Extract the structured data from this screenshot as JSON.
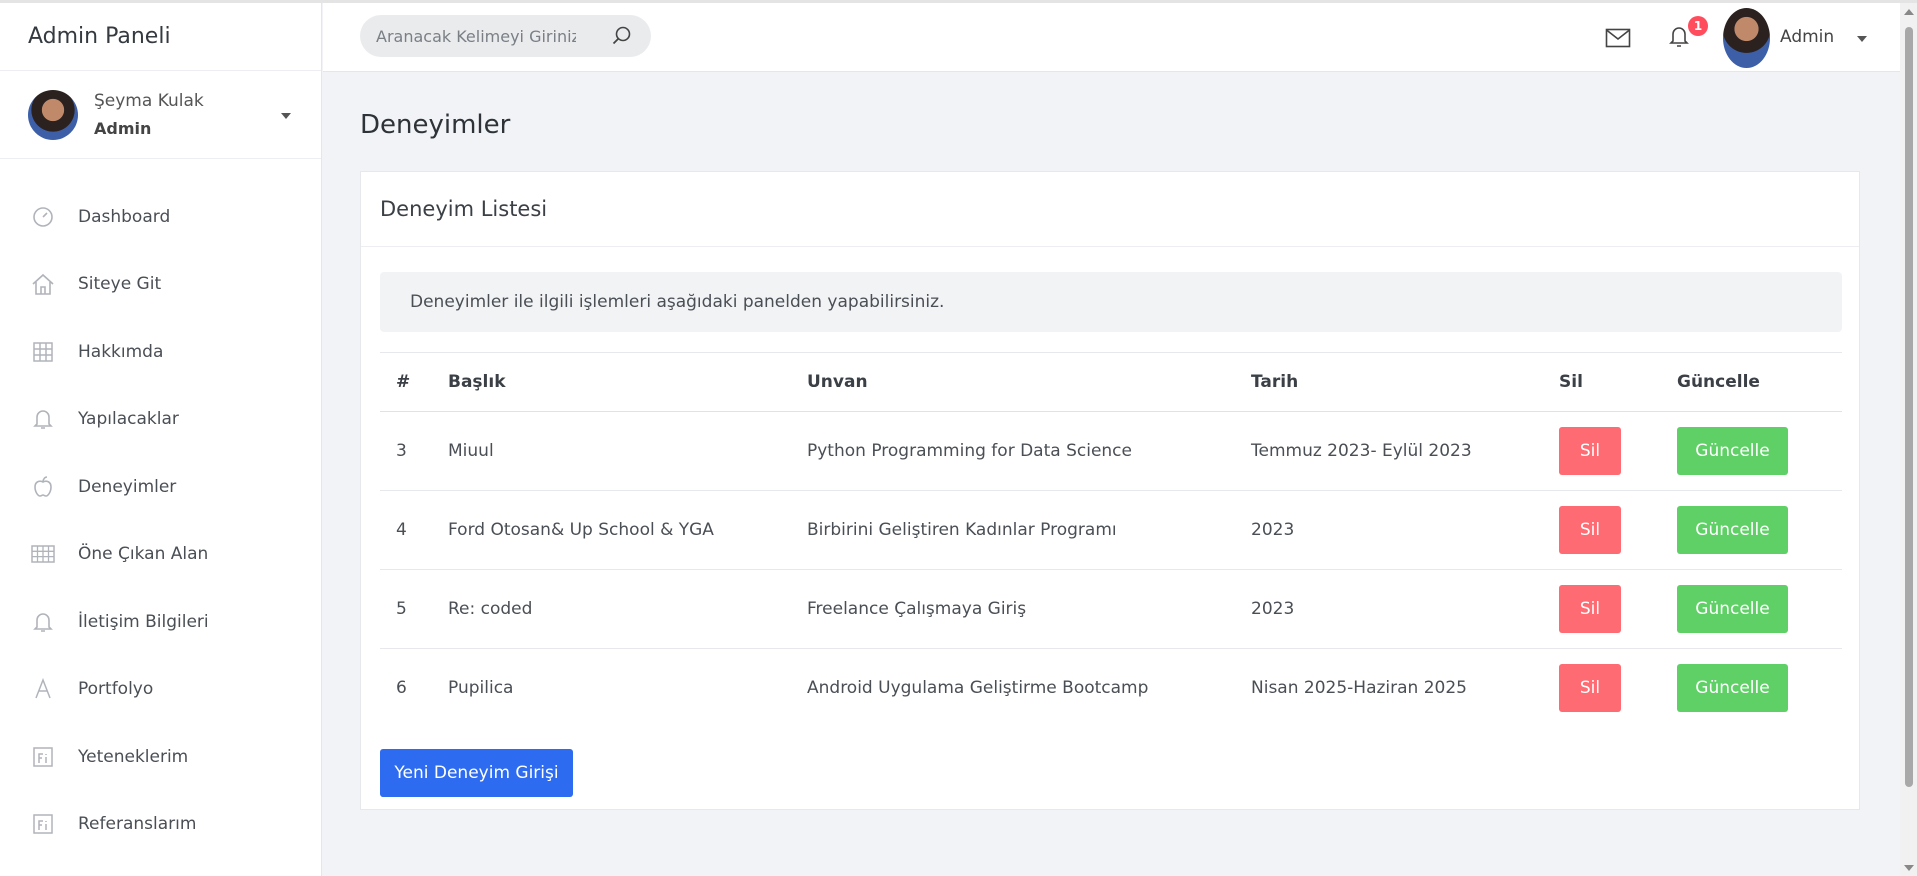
{
  "sidebar": {
    "brand": "Admin Paneli",
    "profile": {
      "name": "Şeyma Kulak",
      "role": "Admin"
    },
    "items": [
      {
        "label": "Dashboard",
        "icon": "gauge-icon"
      },
      {
        "label": "Siteye Git",
        "icon": "home-icon"
      },
      {
        "label": "Hakkımda",
        "icon": "grid-icon"
      },
      {
        "label": "Yapılacaklar",
        "icon": "bell-icon"
      },
      {
        "label": "Deneyimler",
        "icon": "apple-icon"
      },
      {
        "label": "Öne Çıkan Alan",
        "icon": "grid-large-icon"
      },
      {
        "label": "İletişim Bilgileri",
        "icon": "bell-icon"
      },
      {
        "label": "Portfolyo",
        "icon": "letter-a-icon"
      },
      {
        "label": "Yeteneklerim",
        "icon": "fi-icon"
      },
      {
        "label": "Referanslarım",
        "icon": "fi-icon"
      }
    ]
  },
  "header": {
    "search_placeholder": "Aranacak Kelimeyi Giriniz",
    "notification_count": "1",
    "user_name": "Admin"
  },
  "main": {
    "page_title": "Deneyimler",
    "card_title": "Deneyim Listesi",
    "info": "Deneyimler ile ilgili işlemleri aşağıdaki panelden yapabilirsiniz.",
    "columns": [
      "#",
      "Başlık",
      "Unvan",
      "Tarih",
      "Sil",
      "Güncelle"
    ],
    "rows": [
      {
        "id": "3",
        "title": "Miuul",
        "position": "Python Programming for Data Science",
        "date": "Temmuz 2023- Eylül 2023",
        "delete": "Sil",
        "update": "Güncelle"
      },
      {
        "id": "4",
        "title": "Ford Otosan& Up School & YGA",
        "position": "Birbirini Geliştiren Kadınlar Programı",
        "date": "2023",
        "delete": "Sil",
        "update": "Güncelle"
      },
      {
        "id": "5",
        "title": "Re: coded",
        "position": "Freelance Çalışmaya Giriş",
        "date": "2023",
        "delete": "Sil",
        "update": "Güncelle"
      },
      {
        "id": "6",
        "title": "Pupilica",
        "position": "Android Uygulama Geliştirme Bootcamp",
        "date": "Nisan 2025-Haziran 2025",
        "delete": "Sil",
        "update": "Güncelle"
      }
    ],
    "new_button": "Yeni Deneyim Girişi"
  },
  "colors": {
    "delete": "#ff6b72",
    "update": "#5fd066",
    "primary": "#2d6bf0",
    "badge": "#ff4d5e"
  }
}
